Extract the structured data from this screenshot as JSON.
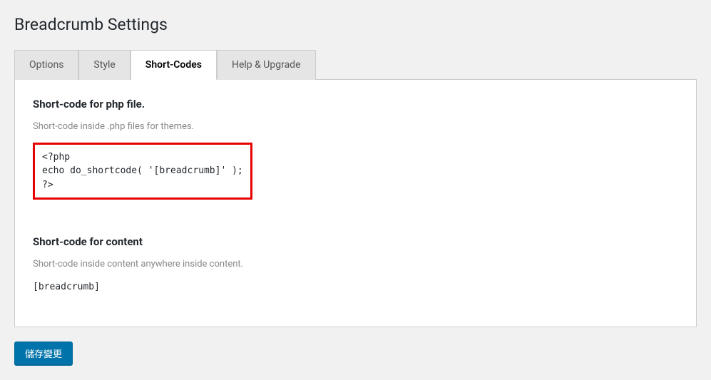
{
  "page": {
    "title": "Breadcrumb Settings"
  },
  "tabs": [
    {
      "label": "Options"
    },
    {
      "label": "Style"
    },
    {
      "label": "Short-Codes"
    },
    {
      "label": "Help & Upgrade"
    }
  ],
  "sections": {
    "php": {
      "title": "Short-code for php file.",
      "description": "Short-code inside .php files for themes.",
      "code": "<?php\necho do_shortcode( '[breadcrumb]' );\n?>"
    },
    "content": {
      "title": "Short-code for content",
      "description": "Short-code inside content anywhere inside content.",
      "code": "[breadcrumb]"
    }
  },
  "buttons": {
    "save": "儲存變更"
  }
}
